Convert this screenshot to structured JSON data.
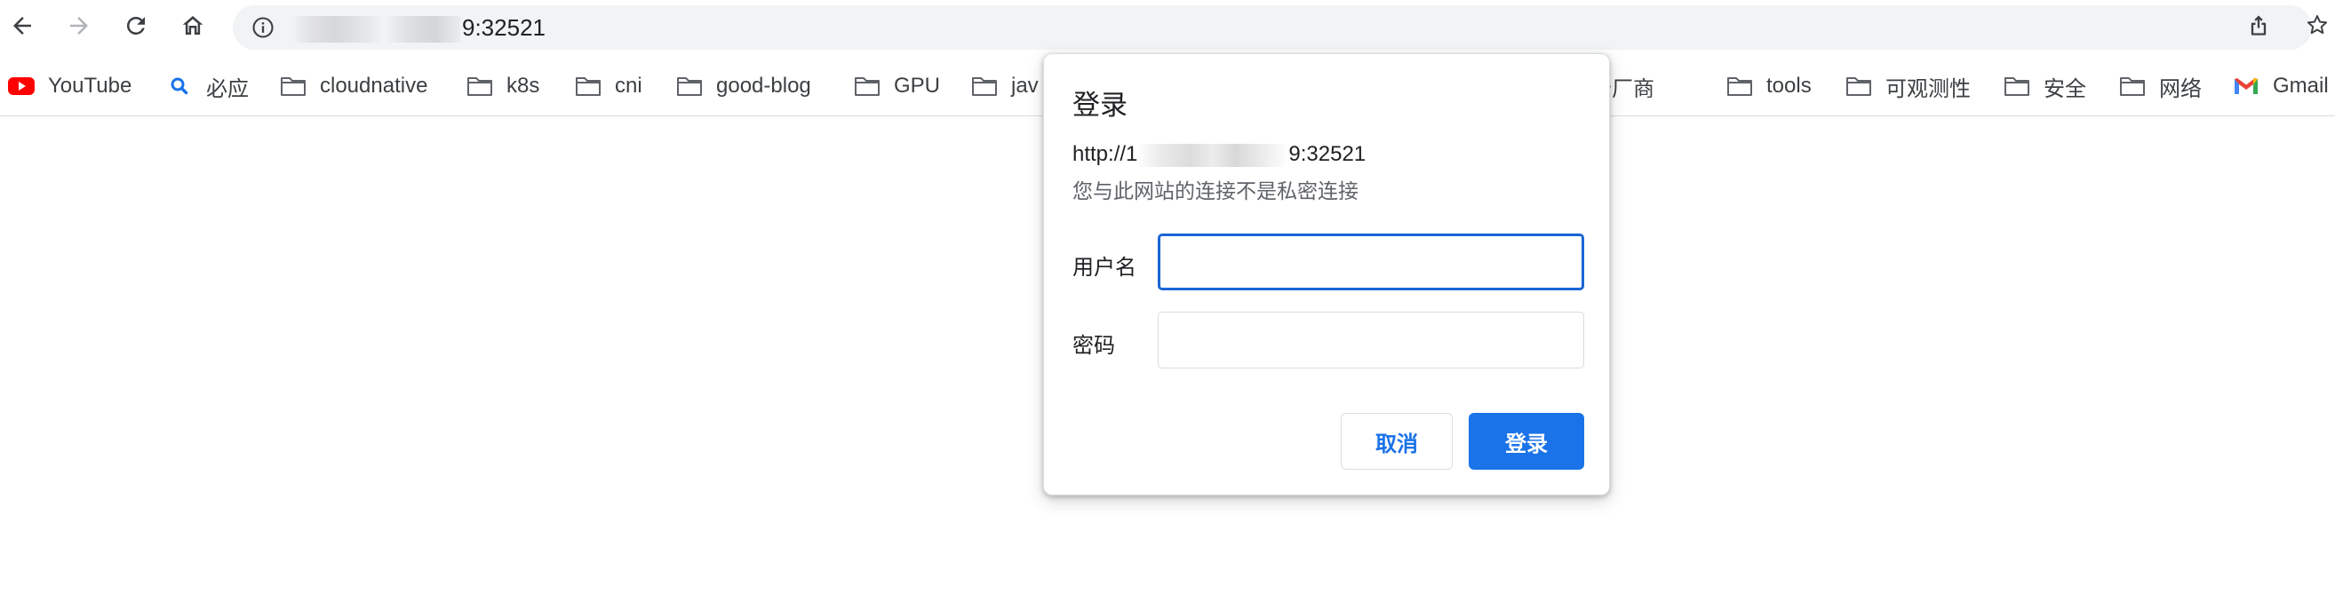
{
  "browser": {
    "url_suffix": "9:32521",
    "icons": {
      "back": "arrow-left-icon",
      "forward": "arrow-right-icon",
      "reload": "reload-icon",
      "home": "home-icon",
      "site_info": "info-icon",
      "share": "share-icon",
      "bookmark": "star-icon"
    }
  },
  "bookmarks": [
    {
      "label": "YouTube",
      "icon": "youtube-icon"
    },
    {
      "label": "必应",
      "icon": "bing-search-icon"
    },
    {
      "label": "cloudnative",
      "icon": "folder-icon"
    },
    {
      "label": "k8s",
      "icon": "folder-icon"
    },
    {
      "label": "cni",
      "icon": "folder-icon"
    },
    {
      "label": "good-blog",
      "icon": "folder-icon"
    },
    {
      "label": "GPU",
      "icon": "folder-icon"
    },
    {
      "label": "jav",
      "icon": "folder-icon"
    },
    {
      "label": "云厂商",
      "icon": "folder-icon"
    },
    {
      "label": "tools",
      "icon": "folder-icon"
    },
    {
      "label": "可观测性",
      "icon": "folder-icon"
    },
    {
      "label": "安全",
      "icon": "folder-icon"
    },
    {
      "label": "网络",
      "icon": "folder-icon"
    },
    {
      "label": "Gmail",
      "icon": "gmail-icon"
    }
  ],
  "dialog": {
    "title": "登录",
    "url_prefix": "http://1",
    "url_suffix": "9:32521",
    "note": "您与此网站的连接不是私密连接",
    "username_label": "用户名",
    "username_value": "",
    "password_label": "密码",
    "password_value": "",
    "cancel_label": "取消",
    "submit_label": "登录"
  },
  "colors": {
    "accent": "#1a73e8",
    "focus_border": "#1a66d6",
    "omnibox_bg": "#f1f3f4",
    "youtube_red": "#ff0000",
    "bing_blue": "#1a73e8"
  }
}
